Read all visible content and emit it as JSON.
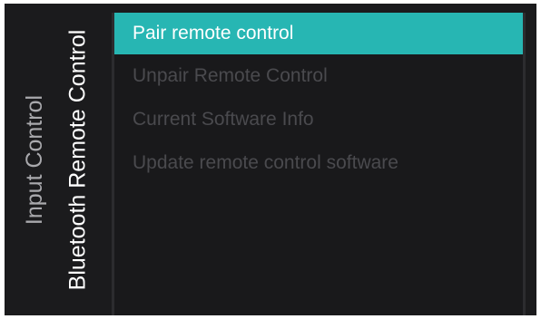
{
  "breadcrumb": {
    "parent": "Input Control",
    "current": "Bluetooth Remote Control"
  },
  "menu": {
    "items": [
      {
        "label": "Pair remote control",
        "selected": true,
        "enabled": true
      },
      {
        "label": "Unpair Remote Control",
        "selected": false,
        "enabled": false
      },
      {
        "label": "Current Software Info",
        "selected": false,
        "enabled": false
      },
      {
        "label": "Update remote control software",
        "selected": false,
        "enabled": false
      }
    ]
  },
  "colors": {
    "background": "#1b1b1d",
    "accent": "#27b6b3",
    "disabled_text": "#4a4a4e"
  }
}
